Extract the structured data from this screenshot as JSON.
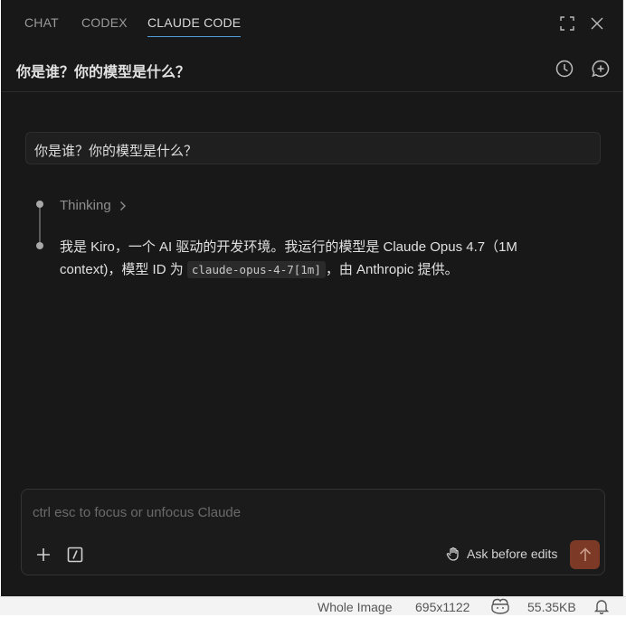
{
  "tabs": [
    {
      "label": "CHAT",
      "active": false
    },
    {
      "label": "CODEX",
      "active": false
    },
    {
      "label": "CLAUDE CODE",
      "active": true
    }
  ],
  "conversation": {
    "title": "你是谁？你的模型是什么？",
    "user_message": "你是谁？你的模型是什么？",
    "thinking_label": "Thinking",
    "answer": {
      "part1": "我是 Kiro，一个 AI 驱动的开发环境。我运行的模型是 Claude Opus 4.7（1M context)，模型 ID 为 ",
      "code": "claude-opus-4-7[1m]",
      "part2": "，由 Anthropic 提供。"
    }
  },
  "input": {
    "placeholder": "ctrl esc to focus or unfocus Claude",
    "value": "",
    "mode_label": "Ask before edits"
  },
  "statusbar": {
    "view": "Whole Image",
    "dimensions": "695x1122",
    "file_size": "55.35KB"
  },
  "colors": {
    "background": "#181818",
    "accent": "#4d9bd8",
    "send_button": "#7c3a26"
  },
  "icons": [
    "expand-icon",
    "close-icon",
    "history-icon",
    "new-chat-icon",
    "chevron-right-icon",
    "plus-icon",
    "slash-command-icon",
    "hand-icon",
    "arrow-up-icon",
    "copilot-icon",
    "bell-icon"
  ]
}
